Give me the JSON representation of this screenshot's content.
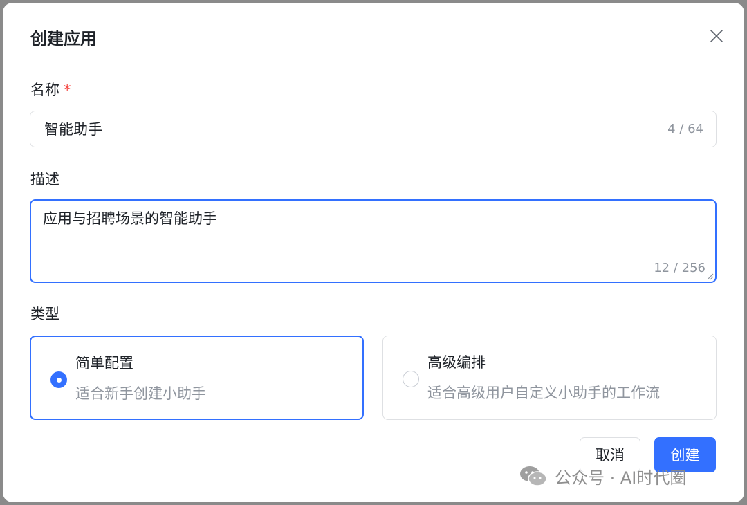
{
  "dialog": {
    "title": "创建应用",
    "close_icon": "close-icon"
  },
  "name_field": {
    "label": "名称",
    "required_mark": "*",
    "value": "智能助手",
    "counter": "4 / 64"
  },
  "description_field": {
    "label": "描述",
    "value": "应用与招聘场景的智能助手",
    "counter": "12 / 256"
  },
  "type_field": {
    "label": "类型",
    "options": [
      {
        "title": "简单配置",
        "description": "适合新手创建小助手",
        "selected": true
      },
      {
        "title": "高级编排",
        "description": "适合高级用户自定义小助手的工作流",
        "selected": false
      }
    ]
  },
  "footer": {
    "cancel_label": "取消",
    "create_label": "创建"
  },
  "watermark": {
    "icon": "wechat-icon",
    "text": "公众号 · AI时代圈"
  },
  "colors": {
    "accent": "#3370ff",
    "required": "#f54a45",
    "muted_text": "#8f959e",
    "border": "#dee0e3"
  }
}
